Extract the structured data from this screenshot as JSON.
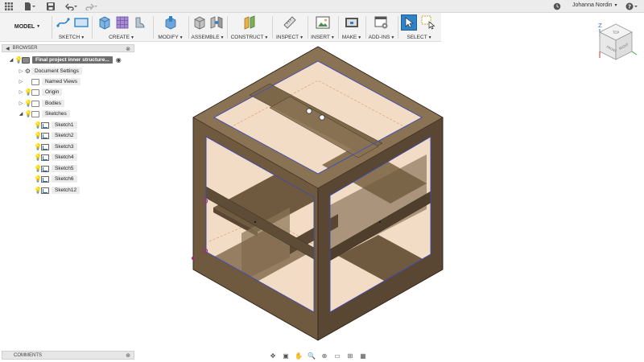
{
  "topbar": {
    "user_name": "Johanna Nordin",
    "icons": [
      "grid-menu-icon",
      "file-icon",
      "save-icon",
      "undo-icon",
      "redo-icon",
      "clock-icon",
      "help-icon"
    ]
  },
  "toolbar": {
    "workspace": "MODEL",
    "groups": {
      "sketch": "SKETCH",
      "create": "CREATE",
      "modify": "MODIFY",
      "assemble": "ASSEMBLE",
      "construct": "CONSTRUCT",
      "inspect": "INSPECT",
      "insert": "INSERT",
      "make": "MAKE",
      "addins": "ADD-INS",
      "select": "SELECT"
    }
  },
  "browser": {
    "title": "BROWSER",
    "root": "Final project inner structure...",
    "items": {
      "document_settings": "Document Settings",
      "named_views": "Named Views",
      "origin": "Origin",
      "bodies": "Bodies",
      "sketches": "Sketches"
    },
    "sketches": [
      "Sketch1",
      "Sketch2",
      "Sketch3",
      "Sketch4",
      "Sketch5",
      "Sketch6",
      "Sketch12"
    ]
  },
  "comments": {
    "title": "COMMENTS"
  },
  "viewcube": {
    "faces": [
      "FRONT",
      "RIGHT",
      "TOP"
    ],
    "axis_z": "Z"
  },
  "colors": {
    "wood_light": "#8a7355",
    "wood_mid": "#6f5a40",
    "wood_dark": "#5a4733",
    "interior": "#f2dcc5",
    "edge_blue": "#3b4fc4",
    "select_blue": "#2f84c9"
  }
}
